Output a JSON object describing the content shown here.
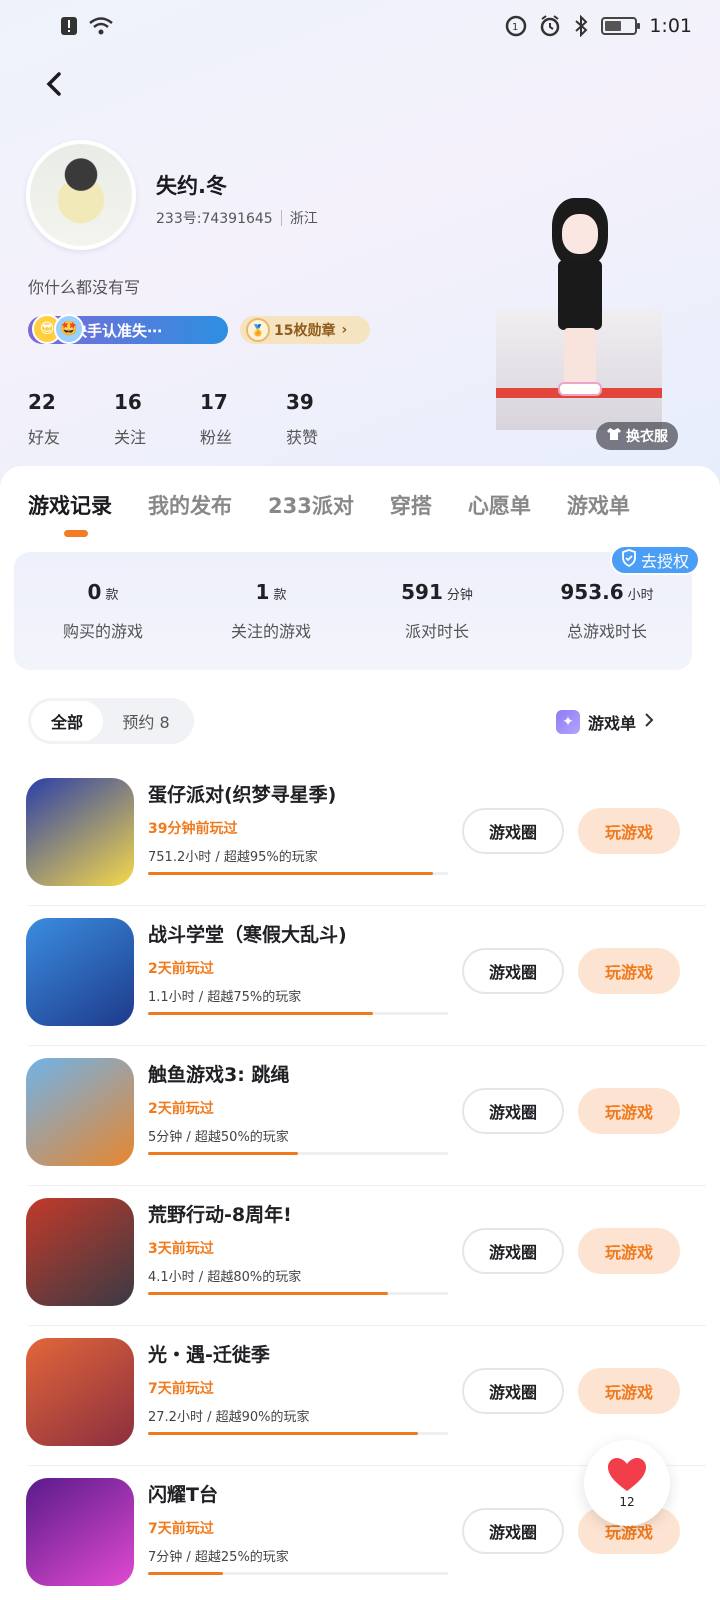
{
  "status_bar": {
    "time": "1:01"
  },
  "profile": {
    "name": "失约.冬",
    "uid": "233号:74391645",
    "region": "浙江",
    "bio": "你什么都没有写",
    "tag_primary": "快手认准失⋯",
    "tag_medals": "15枚勋章",
    "outfit_button": "换衣服"
  },
  "stats": [
    {
      "value": "22",
      "label": "好友"
    },
    {
      "value": "16",
      "label": "关注"
    },
    {
      "value": "17",
      "label": "粉丝"
    },
    {
      "value": "39",
      "label": "获赞"
    }
  ],
  "tabs": [
    "游戏记录",
    "我的发布",
    "233派对",
    "穿搭",
    "心愿单",
    "游戏单"
  ],
  "summary": {
    "auth_badge": "去授权",
    "items": [
      {
        "value": "0",
        "unit": "款",
        "label": "购买的游戏"
      },
      {
        "value": "1",
        "unit": "款",
        "label": "关注的游戏"
      },
      {
        "value": "591",
        "unit": "分钟",
        "label": "派对时长"
      },
      {
        "value": "953.6",
        "unit": "小时",
        "label": "总游戏时长"
      }
    ]
  },
  "filter": {
    "all": "全部",
    "reserved": "预约 8"
  },
  "gamelist_link": "游戏单",
  "games": [
    {
      "title": "蛋仔派对(织梦寻星季)",
      "played": "39分钟前玩过",
      "stats": "751.2小时 / 超越95%的玩家",
      "percentile": 0.95,
      "circle_btn": "游戏圈",
      "play_btn": "玩游戏",
      "icon_colors": [
        "#2a3fa8",
        "#f6d84a"
      ]
    },
    {
      "title": "战斗学堂（寒假大乱斗)",
      "played": "2天前玩过",
      "stats": "1.1小时 / 超越75%的玩家",
      "percentile": 0.75,
      "circle_btn": "游戏圈",
      "play_btn": "玩游戏",
      "icon_colors": [
        "#3b8de0",
        "#1e3a8a"
      ]
    },
    {
      "title": "触鱼游戏3: 跳绳",
      "played": "2天前玩过",
      "stats": "5分钟 / 超越50%的玩家",
      "percentile": 0.5,
      "circle_btn": "游戏圈",
      "play_btn": "玩游戏",
      "icon_colors": [
        "#6fb3ea",
        "#e8862e"
      ]
    },
    {
      "title": "荒野行动-8周年!",
      "played": "3天前玩过",
      "stats": "4.1小时 / 超越80%的玩家",
      "percentile": 0.8,
      "circle_btn": "游戏圈",
      "play_btn": "玩游戏",
      "icon_colors": [
        "#c23a2a",
        "#3a3a44"
      ]
    },
    {
      "title": "光・遇-迁徙季",
      "played": "7天前玩过",
      "stats": "27.2小时 / 超越90%的玩家",
      "percentile": 0.9,
      "circle_btn": "游戏圈",
      "play_btn": "玩游戏",
      "icon_colors": [
        "#e2663a",
        "#8a2f3f"
      ]
    },
    {
      "title": "闪耀T台",
      "played": "7天前玩过",
      "stats": "7分钟 / 超越25%的玩家",
      "percentile": 0.25,
      "circle_btn": "游戏圈",
      "play_btn": "玩游戏",
      "icon_colors": [
        "#5a1a8a",
        "#e04bd0"
      ]
    }
  ],
  "like": {
    "count": "12"
  }
}
